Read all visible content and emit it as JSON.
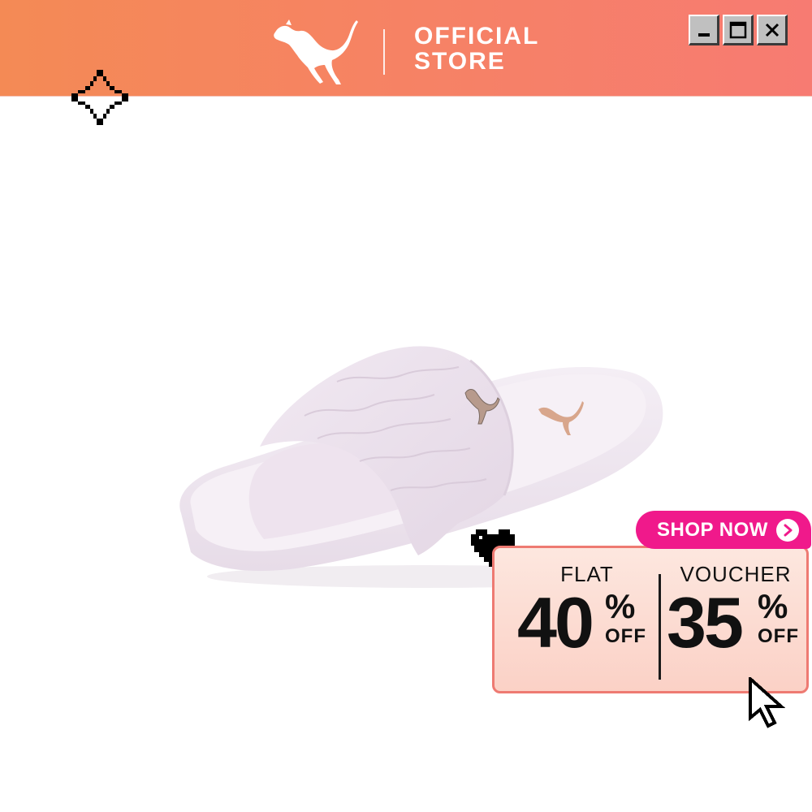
{
  "header": {
    "logo_icon": "puma-cat-logo",
    "title_line1": "OFFICIAL",
    "title_line2": "STORE",
    "brand_gradient": [
      "#f48a55",
      "#f77b72"
    ]
  },
  "window_controls": {
    "minimize_icon": "minimize-icon",
    "maximize_icon": "maximize-icon",
    "close_icon": "close-icon"
  },
  "decor": {
    "sparkle_icon": "sparkle-icon",
    "heart_icon": "pixel-heart-icon",
    "cursor_icon": "pixel-arrow-cursor-icon"
  },
  "product": {
    "image": "pink-slide-sandal",
    "color": "#efe4ee"
  },
  "promo": {
    "cta_label": "SHOP NOW",
    "cta_icon": "chevron-right-icon",
    "cta_color": "#f0198b",
    "deal1": {
      "label": "FLAT",
      "value": "40",
      "percent": "%",
      "suffix": "OFF"
    },
    "deal2": {
      "label": "VOUCHER",
      "value": "35",
      "percent": "%",
      "suffix": "OFF"
    }
  }
}
